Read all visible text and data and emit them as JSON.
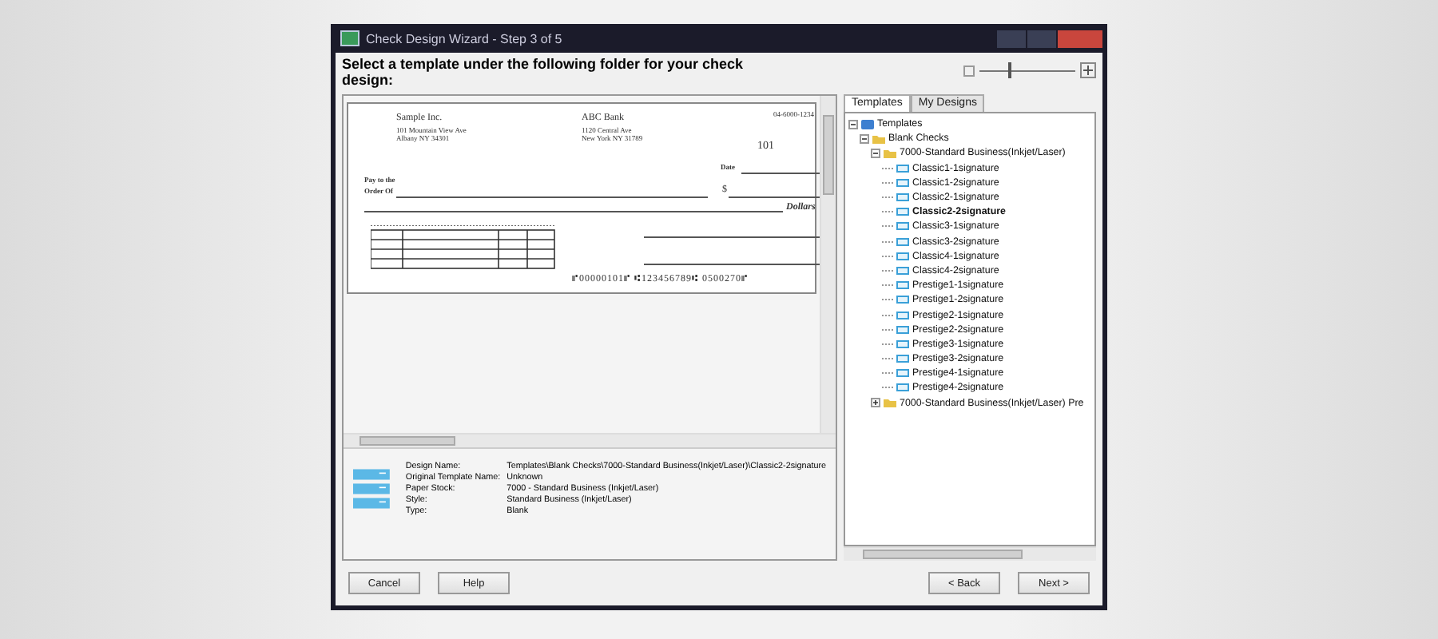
{
  "window": {
    "title": "Check Design Wizard - Step 3 of 5"
  },
  "prompt": "Select a template under the following folder for your check design:",
  "zoom": {
    "level": 0.3
  },
  "check": {
    "company": "Sample Inc.",
    "company_address": [
      "101 Mountain View Ave",
      "Albany NY 34301"
    ],
    "bank": "ABC Bank",
    "bank_address": [
      "1120 Central Ave",
      "New York NY 31789"
    ],
    "routing_fraction": "04-6000-1234",
    "number": "101",
    "date_label": "Date",
    "pay_label": [
      "Pay to the",
      "Order Of"
    ],
    "amount_label": "$",
    "dollars_label": "Dollars",
    "micr": "⑈00000101⑈ ⑆123456789⑆ 0500270⑈"
  },
  "details": [
    {
      "label": "Design Name:",
      "value": "Templates\\Blank Checks\\7000-Standard Business(Inkjet/Laser)\\Classic2-2signature"
    },
    {
      "label": "Original Template Name:",
      "value": "Unknown"
    },
    {
      "label": "Paper Stock:",
      "value": "7000 - Standard Business (Inkjet/Laser)"
    },
    {
      "label": "Style:",
      "value": "Standard Business (Inkjet/Laser)"
    },
    {
      "label": "Type:",
      "value": "Blank"
    }
  ],
  "tabs": [
    {
      "label": "Templates",
      "selected": true
    },
    {
      "label": "My Designs",
      "selected": false
    }
  ],
  "tree": [
    {
      "label": "Templates",
      "kind": "root",
      "expanded": true,
      "children": [
        {
          "label": "Blank Checks",
          "kind": "folder",
          "expanded": true,
          "children": [
            {
              "label": "7000-Standard Business(Inkjet/Laser)",
              "kind": "folder",
              "expanded": true,
              "children": [
                {
                  "label": "Classic1-1signature",
                  "kind": "template",
                  "selected": false
                },
                {
                  "label": "Classic1-2signature",
                  "kind": "template",
                  "selected": false
                },
                {
                  "label": "Classic2-1signature",
                  "kind": "template",
                  "selected": false
                },
                {
                  "label": "Classic2-2signature",
                  "kind": "template",
                  "selected": true
                },
                {
                  "label": "Classic3-1signature",
                  "kind": "template",
                  "selected": false
                },
                {
                  "label": "Classic3-2signature",
                  "kind": "template",
                  "selected": false
                },
                {
                  "label": "Classic4-1signature",
                  "kind": "template",
                  "selected": false
                },
                {
                  "label": "Classic4-2signature",
                  "kind": "template",
                  "selected": false
                },
                {
                  "label": "Prestige1-1signature",
                  "kind": "template",
                  "selected": false
                },
                {
                  "label": "Prestige1-2signature",
                  "kind": "template",
                  "selected": false
                },
                {
                  "label": "Prestige2-1signature",
                  "kind": "template",
                  "selected": false
                },
                {
                  "label": "Prestige2-2signature",
                  "kind": "template",
                  "selected": false
                },
                {
                  "label": "Prestige3-1signature",
                  "kind": "template",
                  "selected": false
                },
                {
                  "label": "Prestige3-2signature",
                  "kind": "template",
                  "selected": false
                },
                {
                  "label": "Prestige4-1signature",
                  "kind": "template",
                  "selected": false
                },
                {
                  "label": "Prestige4-2signature",
                  "kind": "template",
                  "selected": false
                }
              ]
            },
            {
              "label": "7000-Standard Business(Inkjet/Laser) Pre",
              "kind": "folder",
              "expanded": false
            }
          ]
        }
      ]
    }
  ],
  "buttons_left": [
    "Cancel",
    "Help"
  ],
  "buttons_right": [
    "< Back",
    "Next >"
  ]
}
